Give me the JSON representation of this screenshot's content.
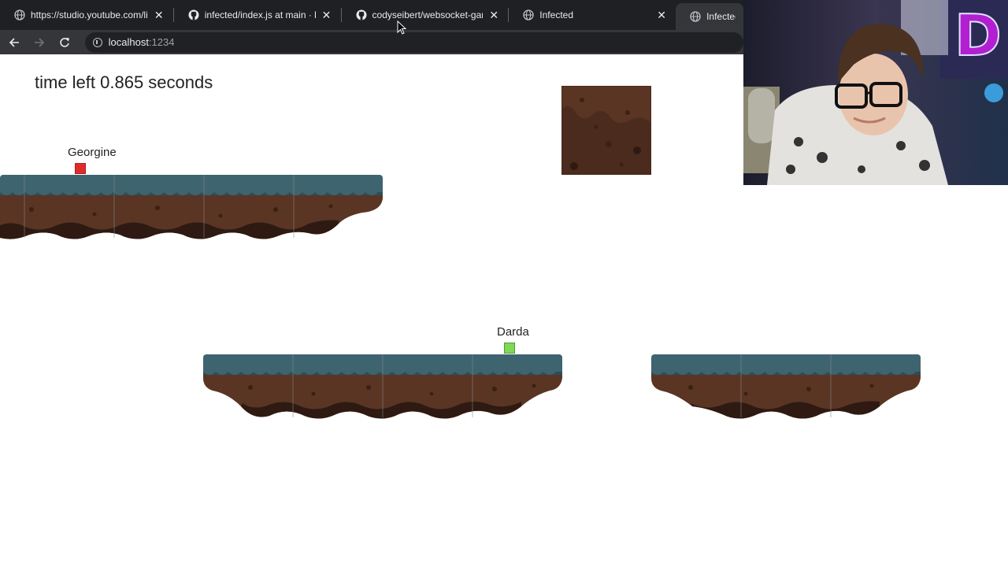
{
  "tabs": [
    {
      "title": "https://studio.youtube.com/live",
      "favicon": "globe-icon",
      "active": false
    },
    {
      "title": "infected/index.js at main · brrea",
      "favicon": "github-icon",
      "active": false
    },
    {
      "title": "codyseibert/websocket-game",
      "favicon": "github-icon",
      "active": false
    },
    {
      "title": "Infected",
      "favicon": "globe-icon",
      "active": false
    },
    {
      "title": "Infected",
      "favicon": "globe-icon",
      "active": true
    }
  ],
  "address": {
    "host": "localhost",
    "port": ":1234"
  },
  "game": {
    "timer_text": "time left 0.865 seconds",
    "players": [
      {
        "name": "Georgine",
        "color": "#e02b2b"
      },
      {
        "name": "Darda",
        "color": "#7ed957"
      }
    ]
  },
  "colors": {
    "grass": "#3e6470",
    "dirt": "#5a3524",
    "dirt_dark": "#2e1a12"
  }
}
